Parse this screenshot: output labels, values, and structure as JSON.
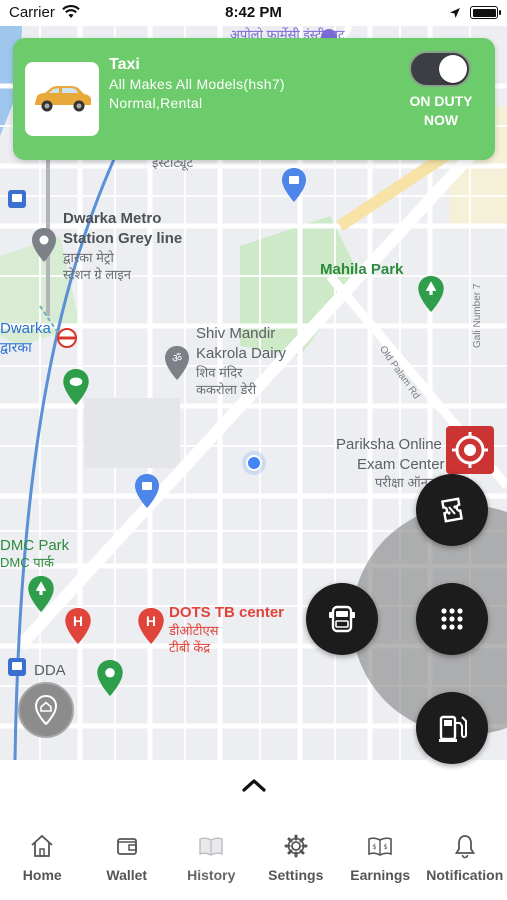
{
  "status_bar": {
    "carrier": "Carrier",
    "time": "8:42 PM"
  },
  "duty_card": {
    "vehicle_type": "Taxi",
    "vehicle_model": "All Makes All Models(hsh7)",
    "service_types": "Normal,Rental",
    "duty_status_line1": "ON DUTY",
    "duty_status_line2": "NOW",
    "toggle_on": true,
    "color": "#6ccb6a"
  },
  "map": {
    "labels": {
      "top_hindi": "अपोलो फार्मेसी इंस्टीट्यूट",
      "institute": "इंस्टीट्यूट",
      "dwarka_metro_1": "Dwarka Metro",
      "dwarka_metro_2": "Station Grey line",
      "dwarka_metro_hi_1": "द्वारका मेट्रो",
      "dwarka_metro_hi_2": "स्टेशन ग्रे लाइन",
      "dwarka_en": "Dwarka",
      "dwarka_hi": "द्वारका",
      "mahila_park": "Mahila Park",
      "gali_no": "Gali Number 7",
      "old_palam_rd": "Old Palam Rd",
      "shiv_mandir_1": "Shiv Mandir",
      "shiv_mandir_2": "Kakrola Dairy",
      "shiv_mandir_hi_1": "शिव मंदिर",
      "shiv_mandir_hi_2": "ककरोला डेरी",
      "pariksha_1": "Pariksha Online",
      "pariksha_2": "Exam Center",
      "pariksha_hi": "परीक्षा ऑनलाइन",
      "dmc_park": "DMC Park",
      "dmc_park_hi": "DMC पार्क",
      "dots_tb": "DOTS TB center",
      "dots_tb_hi_1": "डीओटीएस",
      "dots_tb_hi_2": "टीबी केंद्र",
      "dda": "DDA"
    }
  },
  "fabs": {
    "recenter_color": "#cc3333",
    "icons": [
      "ticket-icon",
      "car-front-icon",
      "grid-menu-icon",
      "fuel-station-icon",
      "home-pin-icon",
      "target-icon"
    ]
  },
  "tabs": [
    {
      "label": "Home",
      "icon": "home-icon"
    },
    {
      "label": "Wallet",
      "icon": "wallet-icon"
    },
    {
      "label": "History",
      "icon": "book-icon"
    },
    {
      "label": "Settings",
      "icon": "gear-icon"
    },
    {
      "label": "Earnings",
      "icon": "earnings-icon"
    },
    {
      "label": "Notification",
      "icon": "bell-icon"
    }
  ]
}
